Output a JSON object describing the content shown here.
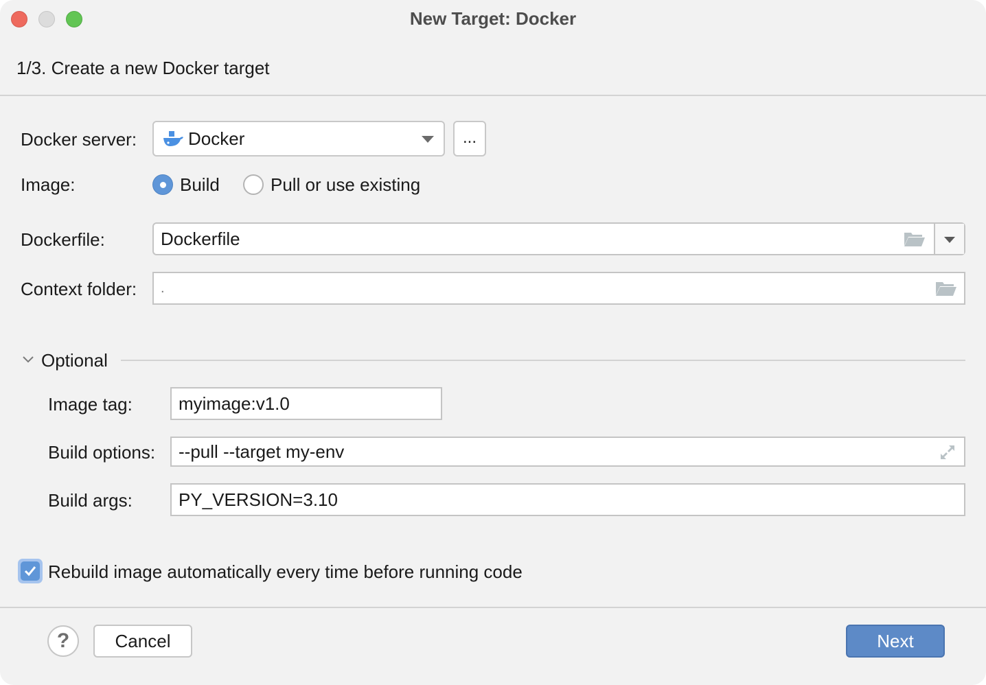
{
  "window": {
    "title": "New Target: Docker"
  },
  "header": {
    "step": "1/3. Create a new Docker target"
  },
  "form": {
    "docker_server": {
      "label": "Docker server:",
      "value": "Docker",
      "icon": "docker-whale-icon",
      "more_button_label": "..."
    },
    "image": {
      "label": "Image:",
      "options": [
        {
          "label": "Build",
          "selected": true
        },
        {
          "label": "Pull or use existing",
          "selected": false
        }
      ]
    },
    "dockerfile": {
      "label": "Dockerfile:",
      "value": "Dockerfile"
    },
    "context_folder": {
      "label": "Context folder:",
      "value": "."
    }
  },
  "optional": {
    "title": "Optional",
    "expanded": true,
    "image_tag": {
      "label": "Image tag:",
      "value": "myimage:v1.0"
    },
    "build_options": {
      "label": "Build options:",
      "value": "--pull --target my-env"
    },
    "build_args": {
      "label": "Build args:",
      "value": "PY_VERSION=3.10"
    }
  },
  "rebuild": {
    "label": "Rebuild image automatically every time before running code",
    "checked": true
  },
  "footer": {
    "help_label": "?",
    "cancel_label": "Cancel",
    "next_label": "Next"
  },
  "colors": {
    "accent": "#5d8ac7",
    "radio_selected": "#5f96d8",
    "close": "#ee6a5e",
    "maximize": "#62c554"
  }
}
